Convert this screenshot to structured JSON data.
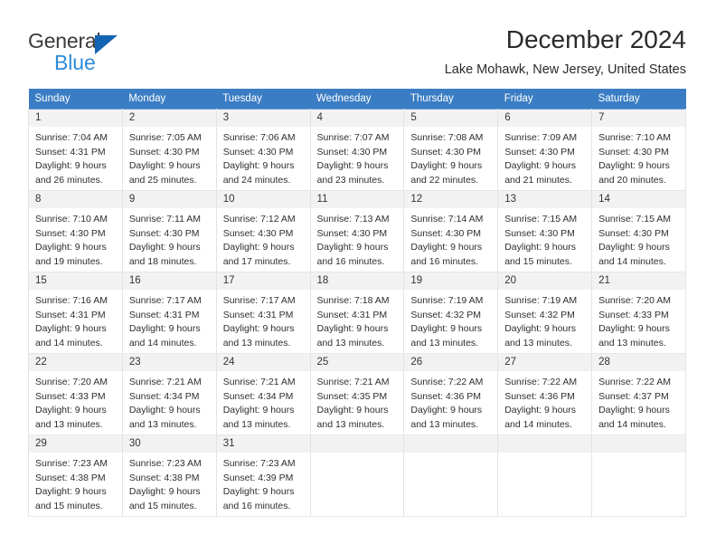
{
  "brand": {
    "name_part1": "General",
    "name_part2": "Blue",
    "triangle_color": "#1464b4",
    "blue_color": "#2e8bd8"
  },
  "header": {
    "title": "December 2024",
    "subtitle": "Lake Mohawk, New Jersey, United States"
  },
  "calendar": {
    "header_bg": "#3b7dc4",
    "daynum_bg": "#f2f2f2",
    "weekdays": [
      "Sunday",
      "Monday",
      "Tuesday",
      "Wednesday",
      "Thursday",
      "Friday",
      "Saturday"
    ],
    "weeks": [
      [
        {
          "day": "1",
          "sunrise": "Sunrise: 7:04 AM",
          "sunset": "Sunset: 4:31 PM",
          "daylight1": "Daylight: 9 hours",
          "daylight2": "and 26 minutes."
        },
        {
          "day": "2",
          "sunrise": "Sunrise: 7:05 AM",
          "sunset": "Sunset: 4:30 PM",
          "daylight1": "Daylight: 9 hours",
          "daylight2": "and 25 minutes."
        },
        {
          "day": "3",
          "sunrise": "Sunrise: 7:06 AM",
          "sunset": "Sunset: 4:30 PM",
          "daylight1": "Daylight: 9 hours",
          "daylight2": "and 24 minutes."
        },
        {
          "day": "4",
          "sunrise": "Sunrise: 7:07 AM",
          "sunset": "Sunset: 4:30 PM",
          "daylight1": "Daylight: 9 hours",
          "daylight2": "and 23 minutes."
        },
        {
          "day": "5",
          "sunrise": "Sunrise: 7:08 AM",
          "sunset": "Sunset: 4:30 PM",
          "daylight1": "Daylight: 9 hours",
          "daylight2": "and 22 minutes."
        },
        {
          "day": "6",
          "sunrise": "Sunrise: 7:09 AM",
          "sunset": "Sunset: 4:30 PM",
          "daylight1": "Daylight: 9 hours",
          "daylight2": "and 21 minutes."
        },
        {
          "day": "7",
          "sunrise": "Sunrise: 7:10 AM",
          "sunset": "Sunset: 4:30 PM",
          "daylight1": "Daylight: 9 hours",
          "daylight2": "and 20 minutes."
        }
      ],
      [
        {
          "day": "8",
          "sunrise": "Sunrise: 7:10 AM",
          "sunset": "Sunset: 4:30 PM",
          "daylight1": "Daylight: 9 hours",
          "daylight2": "and 19 minutes."
        },
        {
          "day": "9",
          "sunrise": "Sunrise: 7:11 AM",
          "sunset": "Sunset: 4:30 PM",
          "daylight1": "Daylight: 9 hours",
          "daylight2": "and 18 minutes."
        },
        {
          "day": "10",
          "sunrise": "Sunrise: 7:12 AM",
          "sunset": "Sunset: 4:30 PM",
          "daylight1": "Daylight: 9 hours",
          "daylight2": "and 17 minutes."
        },
        {
          "day": "11",
          "sunrise": "Sunrise: 7:13 AM",
          "sunset": "Sunset: 4:30 PM",
          "daylight1": "Daylight: 9 hours",
          "daylight2": "and 16 minutes."
        },
        {
          "day": "12",
          "sunrise": "Sunrise: 7:14 AM",
          "sunset": "Sunset: 4:30 PM",
          "daylight1": "Daylight: 9 hours",
          "daylight2": "and 16 minutes."
        },
        {
          "day": "13",
          "sunrise": "Sunrise: 7:15 AM",
          "sunset": "Sunset: 4:30 PM",
          "daylight1": "Daylight: 9 hours",
          "daylight2": "and 15 minutes."
        },
        {
          "day": "14",
          "sunrise": "Sunrise: 7:15 AM",
          "sunset": "Sunset: 4:30 PM",
          "daylight1": "Daylight: 9 hours",
          "daylight2": "and 14 minutes."
        }
      ],
      [
        {
          "day": "15",
          "sunrise": "Sunrise: 7:16 AM",
          "sunset": "Sunset: 4:31 PM",
          "daylight1": "Daylight: 9 hours",
          "daylight2": "and 14 minutes."
        },
        {
          "day": "16",
          "sunrise": "Sunrise: 7:17 AM",
          "sunset": "Sunset: 4:31 PM",
          "daylight1": "Daylight: 9 hours",
          "daylight2": "and 14 minutes."
        },
        {
          "day": "17",
          "sunrise": "Sunrise: 7:17 AM",
          "sunset": "Sunset: 4:31 PM",
          "daylight1": "Daylight: 9 hours",
          "daylight2": "and 13 minutes."
        },
        {
          "day": "18",
          "sunrise": "Sunrise: 7:18 AM",
          "sunset": "Sunset: 4:31 PM",
          "daylight1": "Daylight: 9 hours",
          "daylight2": "and 13 minutes."
        },
        {
          "day": "19",
          "sunrise": "Sunrise: 7:19 AM",
          "sunset": "Sunset: 4:32 PM",
          "daylight1": "Daylight: 9 hours",
          "daylight2": "and 13 minutes."
        },
        {
          "day": "20",
          "sunrise": "Sunrise: 7:19 AM",
          "sunset": "Sunset: 4:32 PM",
          "daylight1": "Daylight: 9 hours",
          "daylight2": "and 13 minutes."
        },
        {
          "day": "21",
          "sunrise": "Sunrise: 7:20 AM",
          "sunset": "Sunset: 4:33 PM",
          "daylight1": "Daylight: 9 hours",
          "daylight2": "and 13 minutes."
        }
      ],
      [
        {
          "day": "22",
          "sunrise": "Sunrise: 7:20 AM",
          "sunset": "Sunset: 4:33 PM",
          "daylight1": "Daylight: 9 hours",
          "daylight2": "and 13 minutes."
        },
        {
          "day": "23",
          "sunrise": "Sunrise: 7:21 AM",
          "sunset": "Sunset: 4:34 PM",
          "daylight1": "Daylight: 9 hours",
          "daylight2": "and 13 minutes."
        },
        {
          "day": "24",
          "sunrise": "Sunrise: 7:21 AM",
          "sunset": "Sunset: 4:34 PM",
          "daylight1": "Daylight: 9 hours",
          "daylight2": "and 13 minutes."
        },
        {
          "day": "25",
          "sunrise": "Sunrise: 7:21 AM",
          "sunset": "Sunset: 4:35 PM",
          "daylight1": "Daylight: 9 hours",
          "daylight2": "and 13 minutes."
        },
        {
          "day": "26",
          "sunrise": "Sunrise: 7:22 AM",
          "sunset": "Sunset: 4:36 PM",
          "daylight1": "Daylight: 9 hours",
          "daylight2": "and 13 minutes."
        },
        {
          "day": "27",
          "sunrise": "Sunrise: 7:22 AM",
          "sunset": "Sunset: 4:36 PM",
          "daylight1": "Daylight: 9 hours",
          "daylight2": "and 14 minutes."
        },
        {
          "day": "28",
          "sunrise": "Sunrise: 7:22 AM",
          "sunset": "Sunset: 4:37 PM",
          "daylight1": "Daylight: 9 hours",
          "daylight2": "and 14 minutes."
        }
      ],
      [
        {
          "day": "29",
          "sunrise": "Sunrise: 7:23 AM",
          "sunset": "Sunset: 4:38 PM",
          "daylight1": "Daylight: 9 hours",
          "daylight2": "and 15 minutes."
        },
        {
          "day": "30",
          "sunrise": "Sunrise: 7:23 AM",
          "sunset": "Sunset: 4:38 PM",
          "daylight1": "Daylight: 9 hours",
          "daylight2": "and 15 minutes."
        },
        {
          "day": "31",
          "sunrise": "Sunrise: 7:23 AM",
          "sunset": "Sunset: 4:39 PM",
          "daylight1": "Daylight: 9 hours",
          "daylight2": "and 16 minutes."
        },
        {
          "day": "",
          "sunrise": "",
          "sunset": "",
          "daylight1": "",
          "daylight2": ""
        },
        {
          "day": "",
          "sunrise": "",
          "sunset": "",
          "daylight1": "",
          "daylight2": ""
        },
        {
          "day": "",
          "sunrise": "",
          "sunset": "",
          "daylight1": "",
          "daylight2": ""
        },
        {
          "day": "",
          "sunrise": "",
          "sunset": "",
          "daylight1": "",
          "daylight2": ""
        }
      ]
    ]
  }
}
